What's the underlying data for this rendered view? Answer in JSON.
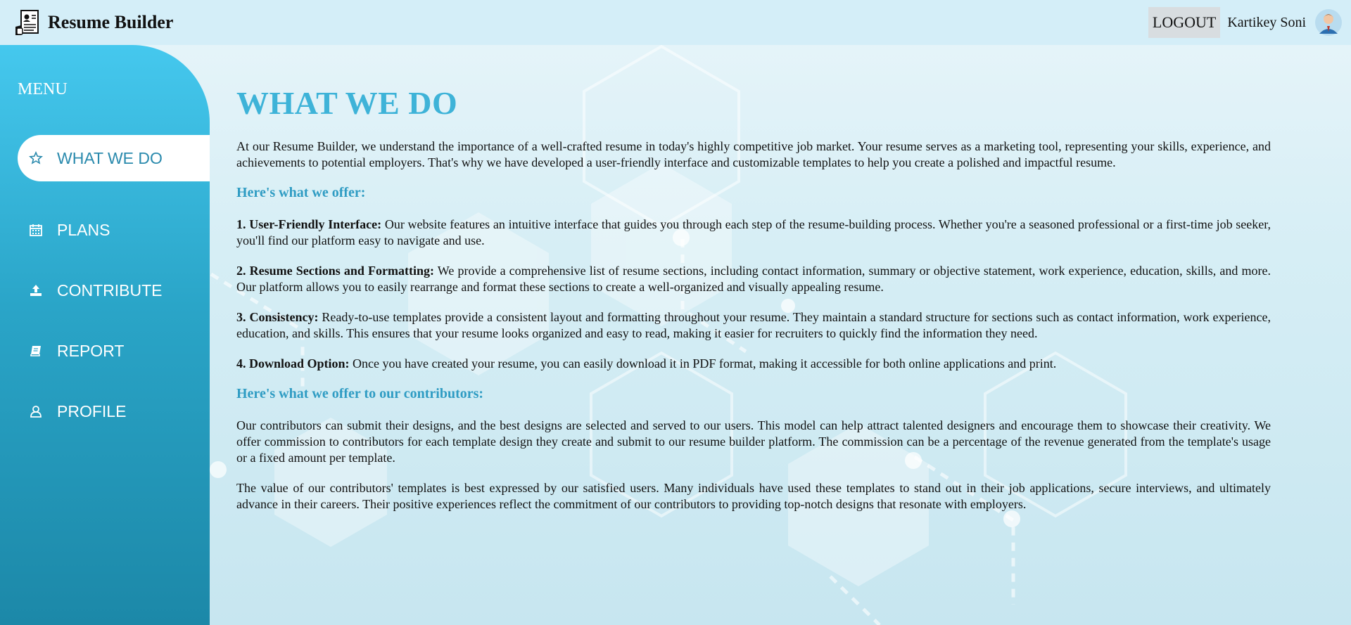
{
  "header": {
    "brand_title": "Resume Builder",
    "logout_label": "LOGOUT",
    "user_name": "Kartikey Soni"
  },
  "sidebar": {
    "menu_title": "MENU",
    "items": [
      {
        "label": "WHAT WE DO",
        "icon": "star-icon",
        "active": true
      },
      {
        "label": "PLANS",
        "icon": "calendar-icon",
        "active": false
      },
      {
        "label": "CONTRIBUTE",
        "icon": "upload-icon",
        "active": false
      },
      {
        "label": "REPORT",
        "icon": "book-icon",
        "active": false
      },
      {
        "label": "PROFILE",
        "icon": "user-icon",
        "active": false
      }
    ]
  },
  "main": {
    "title": "WHAT WE DO",
    "intro": "At our Resume Builder, we understand the importance of a well-crafted resume in today's highly competitive job market. Your resume serves as a marketing tool, representing your skills, experience, and achievements to potential employers. That's why we have developed a user-friendly interface and customizable templates to help you create a polished and impactful resume.",
    "offer_heading": "Here's what we offer:",
    "offers": [
      {
        "title": "1. User-Friendly Interface:",
        "text": "Our website features an intuitive interface that guides you through each step of the resume-building process. Whether you're a seasoned professional or a first-time job seeker, you'll find our platform easy to navigate and use."
      },
      {
        "title": "2. Resume Sections and Formatting:",
        "text": "We provide a comprehensive list of resume sections, including contact information, summary or objective statement, work experience, education, skills, and more. Our platform allows you to easily rearrange and format these sections to create a well-organized and visually appealing resume."
      },
      {
        "title": "3. Consistency:",
        "text": "Ready-to-use templates provide a consistent layout and formatting throughout your resume. They maintain a standard structure for sections such as contact information, work experience, education, and skills. This ensures that your resume looks organized and easy to read, making it easier for recruiters to quickly find the information they need."
      },
      {
        "title": "4. Download Option:",
        "text": "Once you have created your resume, you can easily download it in PDF format, making it accessible for both online applications and print."
      }
    ],
    "contributors_heading": "Here's what we offer to our contributors:",
    "contributors_p1": "Our contributors can submit their designs, and the best designs are selected and served to our users. This model can help attract talented designers and encourage them to showcase their creativity. We offer commission to contributors for each template design they create and submit to our resume builder platform. The commission can be a percentage of the revenue generated from the template's usage or a fixed amount per template.",
    "contributors_p2": "The value of our contributors' templates is best expressed by our satisfied users. Many individuals have used these templates to stand out in their job applications, secure interviews, and ultimately advance in their careers. Their positive experiences reflect the commitment of our contributors to providing top-notch designs that resonate with employers."
  },
  "colors": {
    "accent": "#3eb3d8",
    "heading": "#2f9cc3",
    "sidebar_top": "#45c8ee",
    "sidebar_bottom": "#1c88a8",
    "header_bg": "#d4eef8"
  }
}
